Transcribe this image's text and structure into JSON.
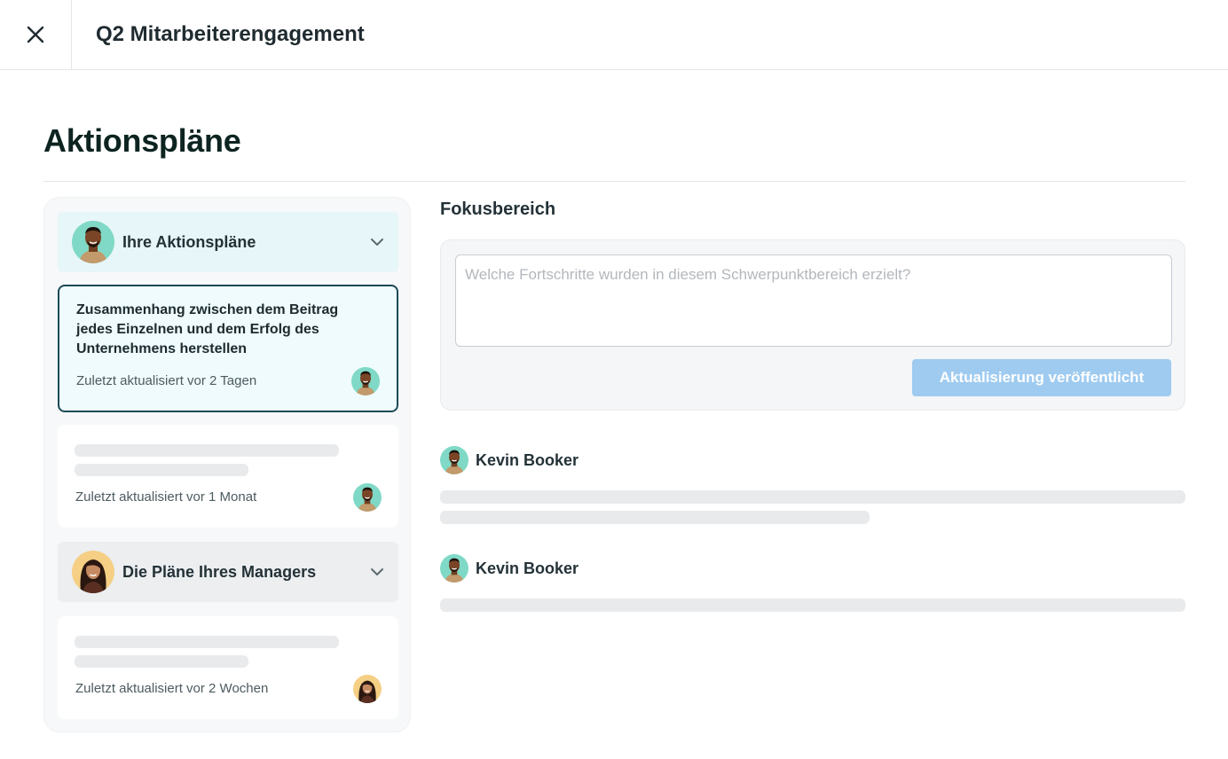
{
  "header": {
    "title": "Q2 Mitarbeiterengagement",
    "close_icon": "close-icon"
  },
  "page": {
    "title": "Aktionspläne"
  },
  "sidebar": {
    "groups": [
      {
        "label": "Ihre Aktionspläne",
        "avatar": "avatar-male",
        "icon": "chevron-down-icon",
        "cards": [
          {
            "title": "Zusammenhang zwischen dem Beitrag jedes Einzelnen und dem Erfolg des Unternehmens herstellen",
            "meta": "Zuletzt aktualisiert vor 2 Tagen",
            "selected": true
          },
          {
            "title": "",
            "meta": "Zuletzt aktualisiert vor 1 Monat",
            "selected": false
          }
        ]
      },
      {
        "label": "Die Pläne Ihres Managers",
        "avatar": "avatar-female",
        "icon": "chevron-down-icon",
        "cards": [
          {
            "title": "",
            "meta": "Zuletzt aktualisiert vor 2 Wochen",
            "selected": false
          }
        ]
      }
    ]
  },
  "focus": {
    "label": "Fokusbereich",
    "placeholder": "Welche Fortschritte wurden in diesem Schwerpunktbereich erzielt?",
    "value": "",
    "publish_label": "Aktualisierung veröffentlicht"
  },
  "comments": [
    {
      "author": "Kevin Booker"
    },
    {
      "author": "Kevin Booker"
    }
  ],
  "colors": {
    "accent_border": "#1c4a57",
    "button_disabled": "#9fcbf0",
    "group_header_mine": "#e7f6f8",
    "group_header_manager": "#eceef0"
  }
}
